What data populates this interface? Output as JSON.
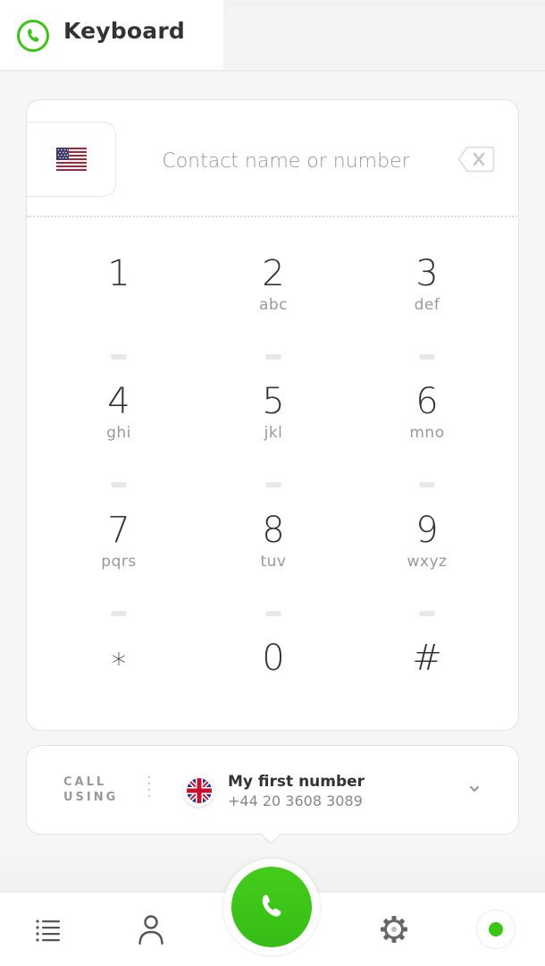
{
  "header": {
    "title": "Keyboard",
    "logo_icon": "phone-circle-icon"
  },
  "dialer": {
    "country_flag": "us-flag-icon",
    "search": {
      "placeholder": "Contact name or number",
      "value": ""
    },
    "backspace_icon": "backspace-icon",
    "keys": [
      {
        "digit": "1",
        "letters": ""
      },
      {
        "digit": "2",
        "letters": "abc"
      },
      {
        "digit": "3",
        "letters": "def"
      },
      {
        "digit": "4",
        "letters": "ghi"
      },
      {
        "digit": "5",
        "letters": "jkl"
      },
      {
        "digit": "6",
        "letters": "mno"
      },
      {
        "digit": "7",
        "letters": "pqrs"
      },
      {
        "digit": "8",
        "letters": "tuv"
      },
      {
        "digit": "9",
        "letters": "wxyz"
      },
      {
        "digit": "*",
        "letters": ""
      },
      {
        "digit": "0",
        "letters": ""
      },
      {
        "digit": "#",
        "letters": ""
      }
    ]
  },
  "call_using": {
    "label_line1": "CALL",
    "label_line2": "USING",
    "flag": "uk-flag-icon",
    "name": "My first number",
    "number": "+44 20 3608 3089"
  },
  "bottom_nav": {
    "items": [
      {
        "name": "call-history",
        "icon": "list-icon"
      },
      {
        "name": "contacts",
        "icon": "person-icon"
      },
      {
        "name": "call",
        "icon": "phone-icon"
      },
      {
        "name": "settings",
        "icon": "gear-icon"
      },
      {
        "name": "status",
        "icon": "status-dot-icon"
      }
    ]
  },
  "colors": {
    "accent": "#3cc417",
    "text": "#333333",
    "muted": "#999999"
  }
}
